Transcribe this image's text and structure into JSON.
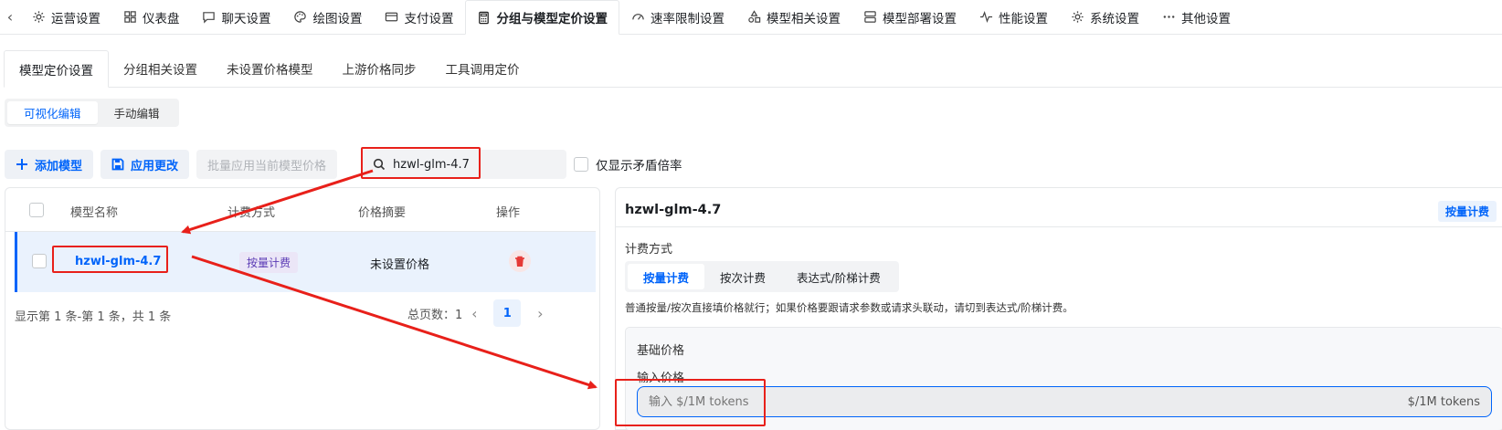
{
  "top_tabs": [
    {
      "label": "运营设置",
      "icon": "gear-icon"
    },
    {
      "label": "仪表盘",
      "icon": "grid-icon"
    },
    {
      "label": "聊天设置",
      "icon": "chat-icon"
    },
    {
      "label": "绘图设置",
      "icon": "palette-icon"
    },
    {
      "label": "支付设置",
      "icon": "card-icon"
    },
    {
      "label": "分组与模型定价设置",
      "icon": "calculator-icon",
      "active": true
    },
    {
      "label": "速率限制设置",
      "icon": "gauge-icon"
    },
    {
      "label": "模型相关设置",
      "icon": "shapes-icon"
    },
    {
      "label": "模型部署设置",
      "icon": "server-icon"
    },
    {
      "label": "性能设置",
      "icon": "pulse-icon"
    },
    {
      "label": "系统设置",
      "icon": "gear-icon"
    },
    {
      "label": "其他设置",
      "icon": "more-icon"
    }
  ],
  "sub_tabs": [
    "模型定价设置",
    "分组相关设置",
    "未设置价格模型",
    "上游价格同步",
    "工具调用定价"
  ],
  "mode_switch": {
    "visual": "可视化编辑",
    "manual": "手动编辑"
  },
  "toolbar": {
    "add_model": "添加模型",
    "apply_changes": "应用更改",
    "batch_apply": "批量应用当前模型价格",
    "search_value": "hzwl-glm-4.7",
    "conflict_only": "仅显示矛盾倍率"
  },
  "table": {
    "headers": {
      "name": "模型名称",
      "billing": "计费方式",
      "summary": "价格摘要",
      "actions": "操作"
    },
    "rows": [
      {
        "name": "hzwl-glm-4.7",
        "billing": "按量计费",
        "summary": "未设置价格"
      }
    ],
    "footer": "显示第 1 条-第 1 条，共 1 条",
    "total_pages_label": "总页数：1",
    "current_page": "1"
  },
  "detail": {
    "title": "hzwl-glm-4.7",
    "billing_tag": "按量计费",
    "billing_label": "计费方式",
    "billing_options": [
      "按量计费",
      "按次计费",
      "表达式/阶梯计费"
    ],
    "hint": "普通按量/按次直接填价格就行；如果价格要跟请求参数或请求头联动，请切到表达式/阶梯计费。",
    "base_price_title": "基础价格",
    "input_price_label": "输入价格",
    "input_placeholder": "输入 $/1M tokens",
    "input_suffix": "$/1M tokens"
  },
  "colors": {
    "accent": "#0064fa",
    "annotation": "#e8201a",
    "danger": "#e53935"
  }
}
